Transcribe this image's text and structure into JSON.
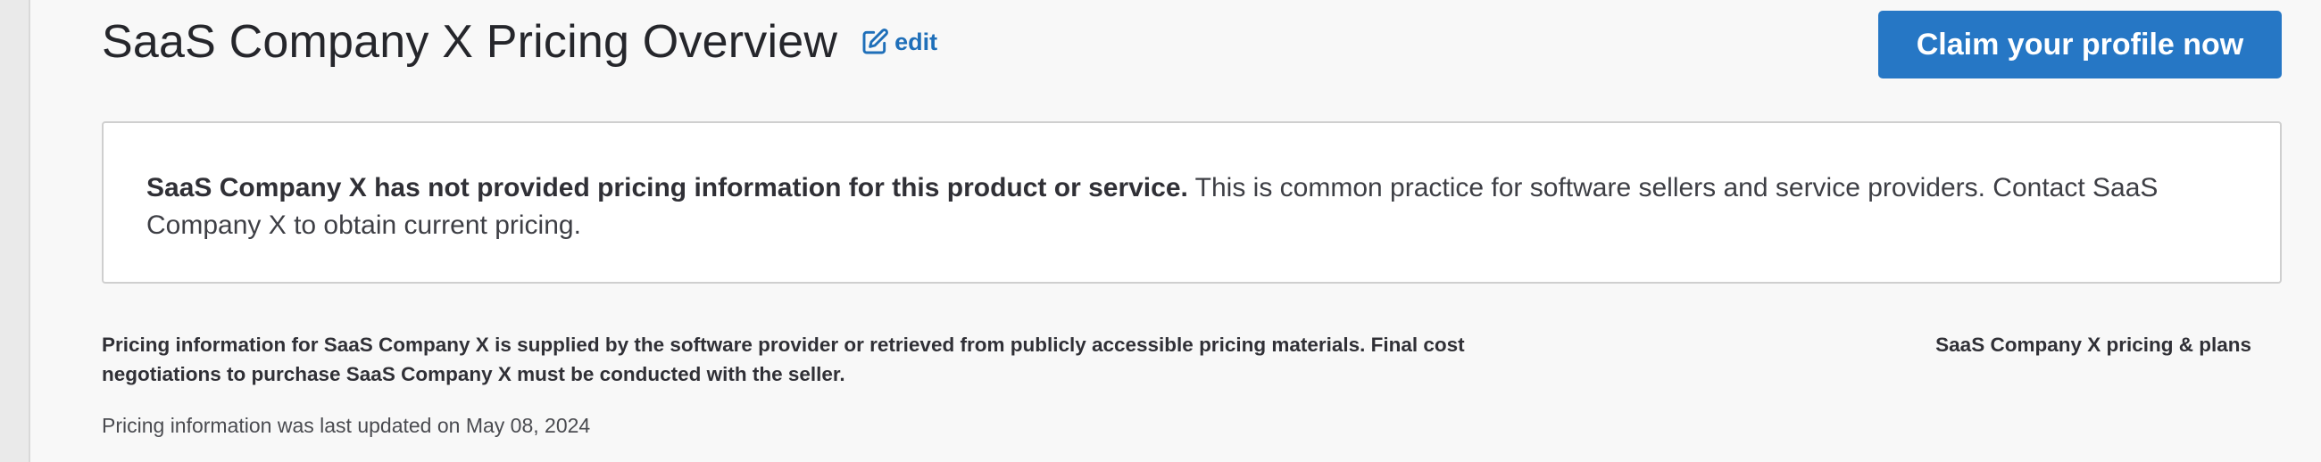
{
  "header": {
    "title": "SaaS Company X Pricing Overview",
    "edit_label": "edit",
    "edit_icon": "edit-icon"
  },
  "claim_button": {
    "label": "Claim your profile now",
    "color": "#2677c5"
  },
  "notice": {
    "bold_text": "SaaS Company X has not provided pricing information for this product or service.",
    "body_text": " This is common practice for software sellers and service providers. Contact SaaS Company X to obtain current pricing."
  },
  "footer": {
    "disclaimer": "Pricing information for SaaS Company X is supplied by the software provider or retrieved from publicly accessible pricing materials. Final cost negotiations to purchase SaaS Company X must be conducted with the seller.",
    "plans_link": "SaaS Company X pricing & plans",
    "last_updated": "Pricing information was last updated on May 08, 2024"
  },
  "colors": {
    "accent": "#2677c5",
    "link": "#1f6fb9",
    "background": "#f8f8f8"
  }
}
